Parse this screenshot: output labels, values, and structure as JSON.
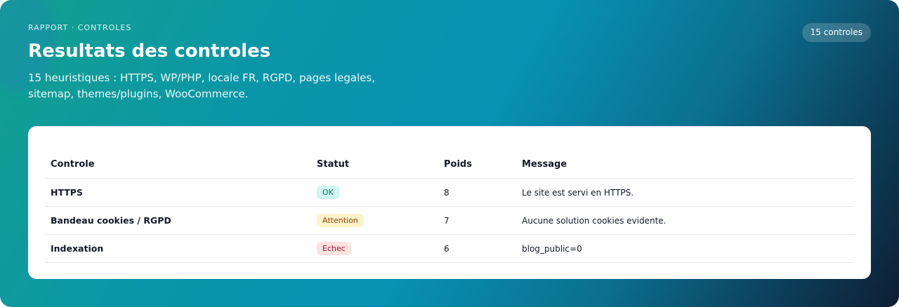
{
  "header": {
    "eyebrow": "RAPPORT · CONTROLES",
    "title": "Resultats des controles",
    "subtitle": "15 heuristiques : HTTPS, WP/PHP, locale FR, RGPD, pages legales, sitemap, themes/plugins, WooCommerce.",
    "count_badge": "15 controles"
  },
  "table": {
    "columns": [
      "Controle",
      "Statut",
      "Poids",
      "Message"
    ],
    "rows": [
      {
        "controle": "HTTPS",
        "statut": "OK",
        "statut_kind": "ok",
        "poids": "8",
        "message": "Le site est servi en HTTPS."
      },
      {
        "controle": "Bandeau cookies / RGPD",
        "statut": "Attention",
        "statut_kind": "warn",
        "poids": "7",
        "message": "Aucune solution cookies evidente."
      },
      {
        "controle": "Indexation",
        "statut": "Echec",
        "statut_kind": "fail",
        "poids": "6",
        "message": "blog_public=0"
      }
    ]
  },
  "colors": {
    "ok_bg": "#cff7f2",
    "warn_bg": "#fef3c7",
    "fail_bg": "#fde2dd"
  }
}
